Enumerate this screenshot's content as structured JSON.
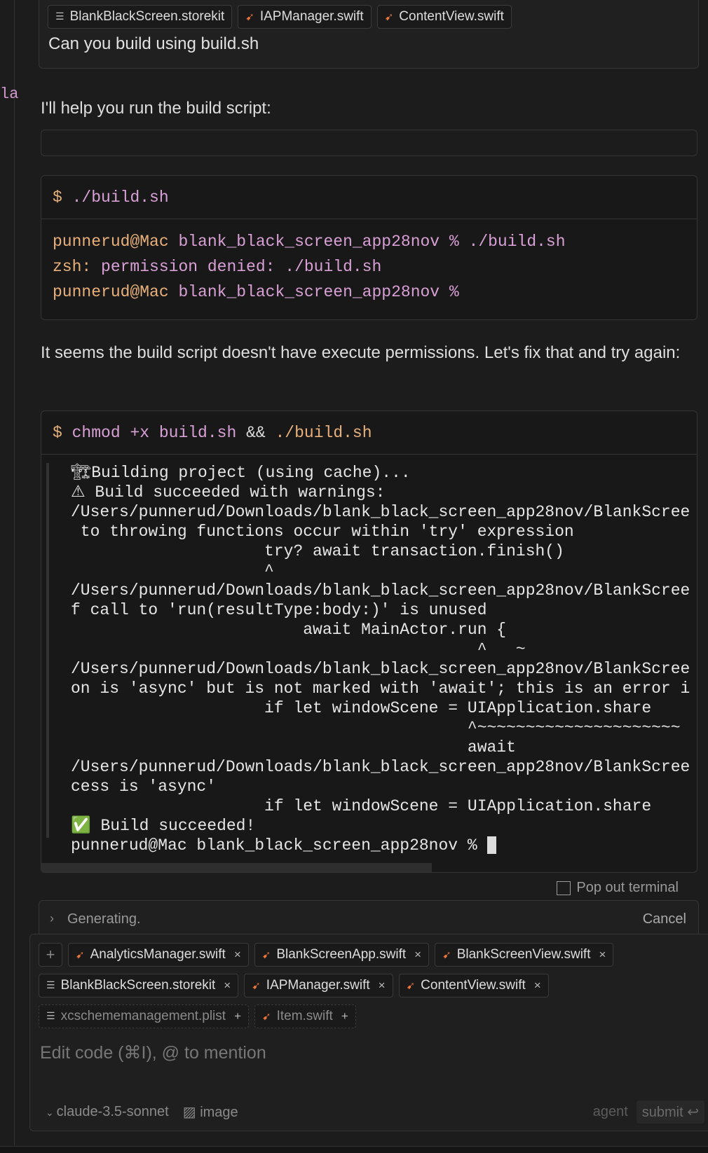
{
  "side_text": "la",
  "user_message": {
    "chips": [
      {
        "icon": "doc-icon",
        "label": "BlankBlackScreen.storekit"
      },
      {
        "icon": "swift-icon",
        "label": "IAPManager.swift"
      },
      {
        "icon": "swift-icon",
        "label": "ContentView.swift"
      }
    ],
    "text": "Can you build using build.sh"
  },
  "assistant": {
    "intro": "I'll help you run the build script:",
    "block1": {
      "prompt": "$",
      "command": "./build.sh",
      "out": [
        [
          [
            "punnerud@Mac",
            "or"
          ],
          [
            " blank_black_screen_app28nov % ./build.sh",
            "pk"
          ]
        ],
        [
          [
            "zsh:",
            "or"
          ],
          [
            " permission denied: ./build.sh",
            "pk"
          ]
        ],
        [
          [
            "punnerud@Mac",
            "or"
          ],
          [
            " blank_black_screen_app28nov %",
            "pk"
          ]
        ]
      ]
    },
    "para": "It seems the build script doesn't have execute permissions. Let's fix that and try again:",
    "block2": {
      "prompt": "$",
      "cmd1": "chmod +x build.sh",
      "op": "&&",
      "cmd2": "./build.sh",
      "lines": [
        "🏗Building project (using cache)...",
        "⚠ Build succeeded with warnings:",
        "/Users/punnerud/Downloads/blank_black_screen_app28nov/BlankScree",
        " to throwing functions occur within 'try' expression",
        "                    try? await transaction.finish()",
        "                    ^",
        "/Users/punnerud/Downloads/blank_black_screen_app28nov/BlankScree",
        "f call to 'run(resultType:body:)' is unused",
        "                        await MainActor.run {",
        "                                          ^   ~",
        "/Users/punnerud/Downloads/blank_black_screen_app28nov/BlankScree",
        "on is 'async' but is not marked with 'await'; this is an error i",
        "                    if let windowScene = UIApplication.share",
        "                                         ^~~~~~~~~~~~~~~~~~~~~~",
        "                                         await",
        "/Users/punnerud/Downloads/blank_black_screen_app28nov/BlankScree",
        "cess is 'async'",
        "                    if let windowScene = UIApplication.share",
        "✅ Build succeeded!",
        "punnerud@Mac blank_black_screen_app28nov % "
      ]
    },
    "pop_out": "Pop out terminal"
  },
  "status": {
    "text": "Generating.",
    "cancel": "Cancel"
  },
  "composer": {
    "chips": [
      {
        "icon": "swift-icon",
        "label": "AnalyticsManager.swift"
      },
      {
        "icon": "swift-icon",
        "label": "BlankScreenApp.swift"
      },
      {
        "icon": "swift-icon",
        "label": "BlankScreenView.swift"
      },
      {
        "icon": "doc-icon",
        "label": "BlankBlackScreen.storekit"
      },
      {
        "icon": "swift-icon",
        "label": "IAPManager.swift"
      },
      {
        "icon": "swift-icon",
        "label": "ContentView.swift"
      }
    ],
    "suggested": [
      {
        "icon": "doc-icon",
        "label": "xcschememanagement.plist"
      },
      {
        "icon": "swift-icon",
        "label": "Item.swift"
      }
    ],
    "placeholder": "Edit code (⌘I), @ to mention",
    "model": "claude-3.5-sonnet",
    "image": "image",
    "mode": "agent",
    "submit": "submit"
  }
}
